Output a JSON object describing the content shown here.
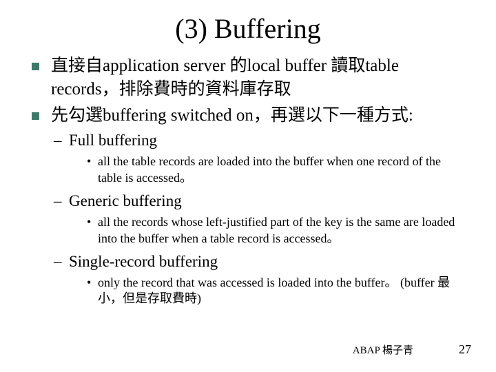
{
  "title": "(3) Buffering",
  "bullets": [
    {
      "text": "直接自application server 的local buffer 讀取table records，排除費時的資料庫存取"
    },
    {
      "text": "先勾選buffering switched on，再選以下一種方式:"
    }
  ],
  "sub": [
    {
      "label": "Full buffering",
      "detail": "all the table records are loaded into the buffer when one record of the table is accessed。"
    },
    {
      "label": "Generic buffering",
      "detail": "all the records whose left-justified part of the key is the same are loaded into the buffer when a table record is accessed。"
    },
    {
      "label": "Single-record buffering",
      "detail": "only the record that was accessed is loaded into the buffer。 (buffer 最小，但是存取費時)"
    }
  ],
  "footer_left": "ABAP 楊子青",
  "page_number": "27"
}
